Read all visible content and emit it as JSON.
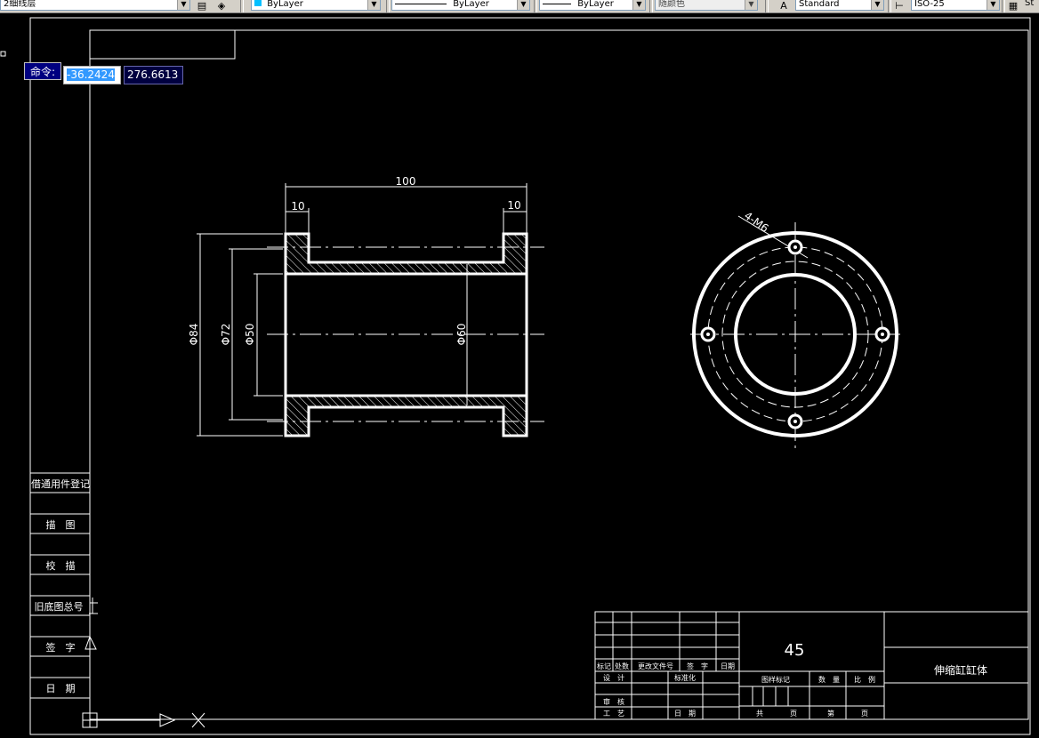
{
  "toolbar": {
    "layer": "2细线层",
    "color": "ByLayer",
    "linetype": "ByLayer",
    "lineweight": "ByLayer",
    "plotstyle": "随颜色",
    "text_style": "Standard",
    "dim_style": "ISO-25",
    "end_text": "St"
  },
  "command": {
    "label": "命令:",
    "x_value": "-36.2424",
    "y_value": "276.6613"
  },
  "drawing": {
    "dims": {
      "overall_length": "100",
      "left_flange": "10",
      "right_flange": "10",
      "dia84": "Φ84",
      "dia72": "Φ72",
      "dia50": "Φ50",
      "dia60": "Φ60",
      "holes": "4-M6"
    },
    "side_table": {
      "r1": "借通用件登记",
      "r2": "描　图",
      "r3": "校　描",
      "r4": "旧底图总号",
      "r5": "签　字",
      "r6": "日　期"
    },
    "title_block": {
      "material": "45",
      "part_name": "伸缩缸缸体",
      "h_mark": "标记",
      "h_count": "处数",
      "h_doc": "更改文件号",
      "h_sign": "签　字",
      "h_date": "日期",
      "design": "设　计",
      "standard": "标准化",
      "check": "审　核",
      "process": "工　艺",
      "date": "日　期",
      "stage_mark": "图样标记",
      "weight": "数　量",
      "scale": "比　例",
      "total": "共",
      "page1": "页",
      "sheet": "第",
      "page2": "页"
    }
  }
}
